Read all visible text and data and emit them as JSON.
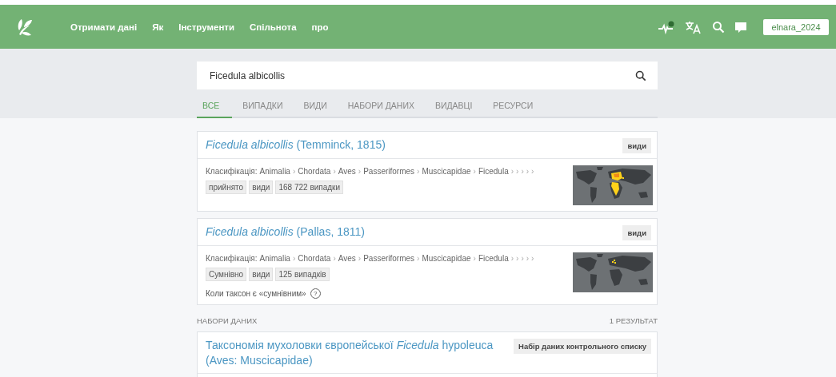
{
  "header": {
    "nav": [
      "Отримати дані",
      "Як",
      "Інструменти",
      "Спільнота",
      "про"
    ],
    "notification": true,
    "user": "elnara_2024"
  },
  "search": {
    "value": "Ficedula albicollis"
  },
  "tabs": [
    {
      "label": "ВСЕ",
      "selected": true
    },
    {
      "label": "ВИПАДКИ",
      "selected": false
    },
    {
      "label": "ВИДИ",
      "selected": false
    },
    {
      "label": "НАБОРИ ДАНИХ",
      "selected": false
    },
    {
      "label": "ВИДАВЦІ",
      "selected": false
    },
    {
      "label": "РЕСУРСИ",
      "selected": false
    }
  ],
  "results": [
    {
      "title": "*Ficedula albicollis* (Temminck, 1815)",
      "type": "види",
      "classification_label": "Класифікація:",
      "path": [
        {
          "name": "Animalia"
        },
        {
          "sep": "›",
          "name": "Chordata"
        },
        {
          "sep": "›",
          "name": "Aves"
        },
        {
          "sep": "›",
          "name": "Passeriformes"
        },
        {
          "sep": "›",
          "name": "Muscicapidae"
        },
        {
          "sep": "›",
          "name": "Ficedula"
        },
        {
          "sep": "›"
        },
        {
          "sep": "›"
        },
        {
          "sep": "›"
        },
        {
          "sep": "›"
        },
        {
          "sep": "›"
        }
      ],
      "tags": [
        "прийнято",
        "види",
        "168 722 випадки"
      ],
      "map": {
        "kind": "wide"
      }
    },
    {
      "title": "*Ficedula albicollis* (Pallas, 1811)",
      "type": "види",
      "classification_label": "Класифікація:",
      "path": [
        {
          "name": "Animalia"
        },
        {
          "sep": "›",
          "name": "Chordata"
        },
        {
          "sep": "›",
          "name": "Aves"
        },
        {
          "sep": "›",
          "name": "Passeriformes"
        },
        {
          "sep": "›",
          "name": "Muscicapidae"
        },
        {
          "sep": "›",
          "name": "Ficedula"
        },
        {
          "sep": "›"
        },
        {
          "sep": "›"
        },
        {
          "sep": "›"
        },
        {
          "sep": "›"
        },
        {
          "sep": "›"
        }
      ],
      "tags": [
        "Сумнівно",
        "види",
        "125 випадків"
      ],
      "note": {
        "text": "Коли таксон є «сумнівним»",
        "icon": "?"
      },
      "map": {
        "kind": "sparse"
      }
    }
  ],
  "datasets": {
    "heading": "НАБОРИ ДАНИХ",
    "count": "1 РЕЗУЛЬТАТ",
    "items": [
      {
        "title": "Таксономія мухоловки європейської *Ficedula* hypoleuca (Aves: Muscicapidae)",
        "type": "Набір даних контрольного списку"
      }
    ]
  }
}
